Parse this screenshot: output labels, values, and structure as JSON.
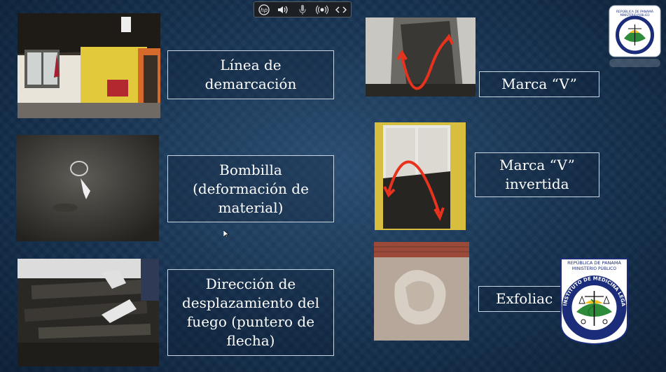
{
  "toolbar": {
    "hp_label": "hp",
    "icons": [
      "hp-logo-icon",
      "speaker-icon",
      "microphone-icon",
      "broadcast-icon",
      "code-icon"
    ]
  },
  "labels": {
    "demarcacion": [
      "Línea de",
      "demarcación"
    ],
    "bombilla": [
      "Bombilla",
      "(deformación de",
      "material)"
    ],
    "direccion": [
      "Dirección de",
      "desplazamiento del",
      "fuego (puntero de",
      "flecha)"
    ],
    "marca_v": "Marca “V”",
    "marca_v_invertida": [
      "Marca “V”",
      "invertida"
    ],
    "exfoliacion": "Exfoliac"
  },
  "logos": {
    "top_line1": "REPÚBLICA DE PANAMÁ",
    "top_line2": "MINISTERIO PÚBLICO",
    "big_line1": "REPÚBLICA DE PANAMÁ",
    "big_line2": "MINISTERIO PÚBLICO",
    "big_arc": "INSTITUTO DE MEDICINA LEGAL Y CIENCIAS FORENSES"
  },
  "colors": {
    "background": "#163352",
    "arrow": "#e8321e",
    "label_border": "#c9d6e3"
  }
}
